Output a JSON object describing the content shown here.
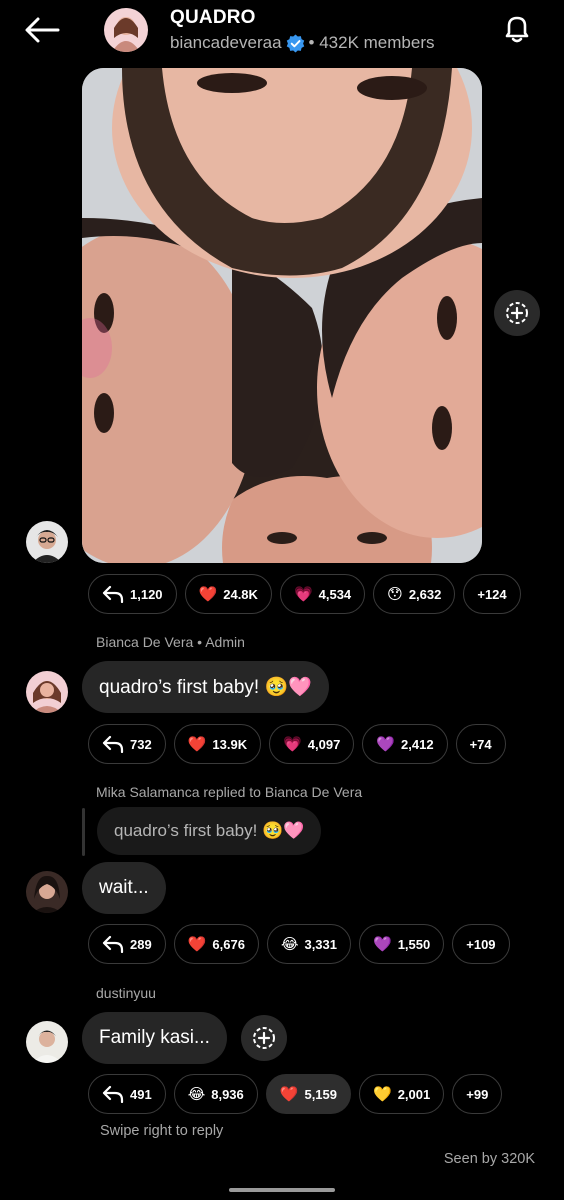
{
  "header": {
    "title": "QUADRO",
    "username": "biancadeveraa",
    "members": "• 432K members",
    "back_icon": "arrow-left-icon",
    "bell_icon": "bell-icon"
  },
  "messages": [
    {
      "sender": "",
      "type": "photo",
      "reactions": [
        {
          "icon": "reply-icon",
          "count": "1,120"
        },
        {
          "icon": "red-heart",
          "glyph": "❤️",
          "count": "24.8K"
        },
        {
          "icon": "sparkling-heart",
          "glyph": "💗",
          "count": "4,534"
        },
        {
          "icon": "hushed-face",
          "glyph": "😯",
          "count": "2,632"
        },
        {
          "icon": "",
          "count": "+124"
        }
      ]
    },
    {
      "sender": "Bianca De Vera • Admin",
      "text": "quadro’s first baby! 🥹🩷",
      "reactions": [
        {
          "icon": "reply-icon",
          "count": "732"
        },
        {
          "icon": "red-heart",
          "glyph": "❤️",
          "count": "13.9K"
        },
        {
          "icon": "sparkling-heart",
          "glyph": "💗",
          "count": "4,097"
        },
        {
          "icon": "purple-heart",
          "glyph": "💜",
          "count": "2,412"
        },
        {
          "icon": "",
          "count": "+74"
        }
      ]
    },
    {
      "sender": "Mika Salamanca replied to Bianca De Vera",
      "quote": "quadro’s first baby! 🥹🩷",
      "text": "wait...",
      "reactions": [
        {
          "icon": "reply-icon",
          "count": "289"
        },
        {
          "icon": "red-heart",
          "glyph": "❤️",
          "count": "6,676"
        },
        {
          "icon": "tears-of-joy",
          "glyph": "😂",
          "count": "3,331"
        },
        {
          "icon": "purple-heart",
          "glyph": "💜",
          "count": "1,550"
        },
        {
          "icon": "",
          "count": "+109"
        }
      ]
    },
    {
      "sender": "dustinyuu",
      "text": "Family kasi...",
      "reactions": [
        {
          "icon": "reply-icon",
          "count": "491"
        },
        {
          "icon": "tears-of-joy",
          "glyph": "😂",
          "count": "8,936"
        },
        {
          "icon": "red-heart",
          "glyph": "❤️",
          "count": "5,159"
        },
        {
          "icon": "yellow-heart",
          "glyph": "💛",
          "count": "2,001"
        },
        {
          "icon": "",
          "count": "+99"
        }
      ]
    }
  ],
  "footer": {
    "hint": "Swipe right to reply",
    "seen": "Seen by 320K"
  },
  "colors": {
    "background": "#000000",
    "bubble": "#262626",
    "verified": "#3897f0",
    "muted_text": "#a8a8a8"
  }
}
